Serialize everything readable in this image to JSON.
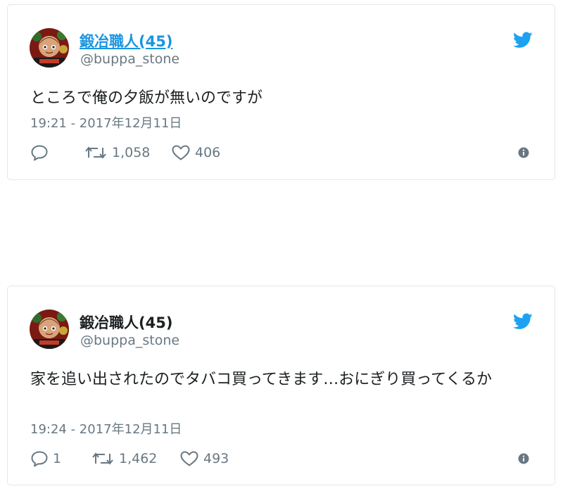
{
  "tweets": [
    {
      "author_name": "鍛冶職人(45)",
      "author_handle": "@buppa_stone",
      "text": "ところで俺の夕飯が無いのですが",
      "timestamp": "19:21 - 2017年12月11日",
      "replies": "",
      "retweets": "1,058",
      "likes": "406"
    },
    {
      "author_name": "鍛冶職人(45)",
      "author_handle": "@buppa_stone",
      "text": "家を追い出されたのでタバコ買ってきます…おにぎり買ってくるか",
      "timestamp": "19:24 - 2017年12月11日",
      "replies": "1",
      "retweets": "1,462",
      "likes": "493"
    }
  ],
  "icons": {
    "brand": "twitter-bird-icon",
    "reply": "reply-icon",
    "retweet": "retweet-icon",
    "like": "heart-icon",
    "info": "info-icon"
  },
  "colors": {
    "twitter_blue": "#1da1f2",
    "link_blue": "#1b95e0",
    "meta_gray": "#697882",
    "border": "#e1e8ed"
  }
}
